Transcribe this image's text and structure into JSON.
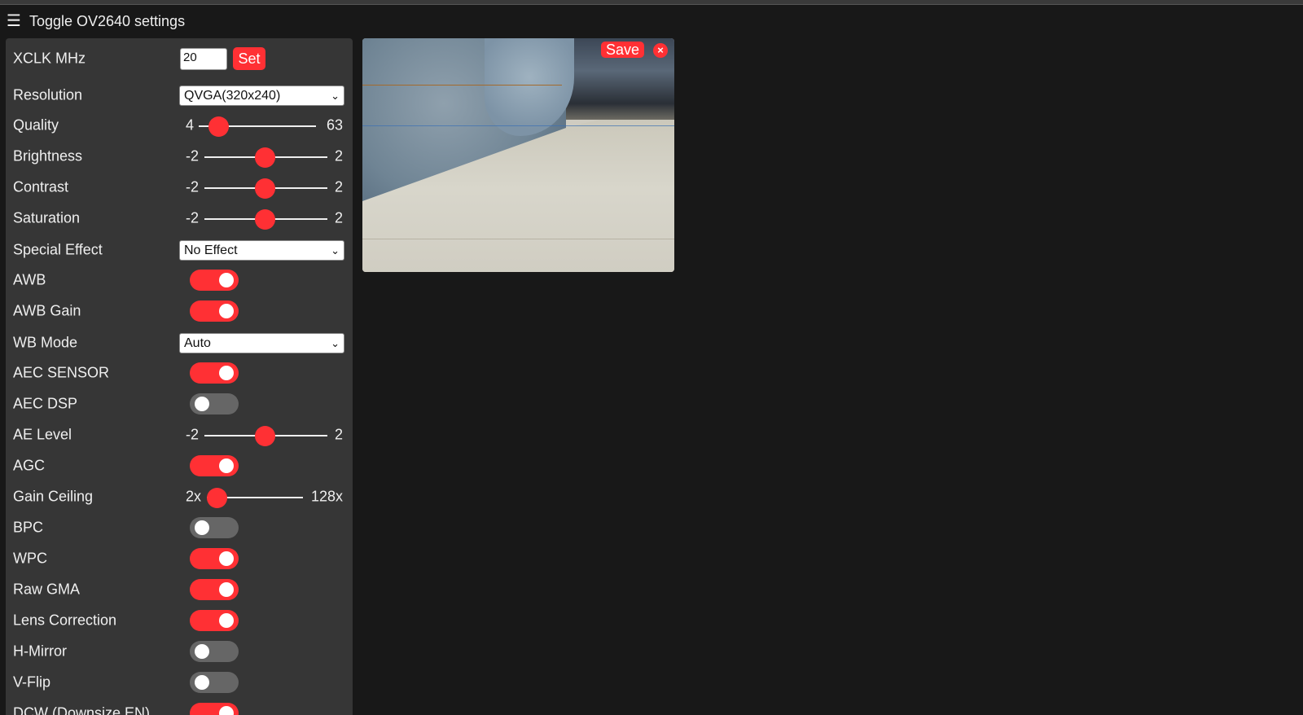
{
  "header": {
    "menu_icon": "☰",
    "title": "Toggle OV2640 settings"
  },
  "settings": {
    "xclk": {
      "label": "XCLK MHz",
      "value": "20",
      "button": "Set"
    },
    "resolution": {
      "label": "Resolution",
      "value": "QVGA(320x240)"
    },
    "quality": {
      "label": "Quality",
      "min": "4",
      "max": "63",
      "value": 10
    },
    "brightness": {
      "label": "Brightness",
      "min": "-2",
      "max": "2",
      "value": 0
    },
    "contrast": {
      "label": "Contrast",
      "min": "-2",
      "max": "2",
      "value": 0
    },
    "saturation": {
      "label": "Saturation",
      "min": "-2",
      "max": "2",
      "value": 0
    },
    "special_effect": {
      "label": "Special Effect",
      "value": "No Effect"
    },
    "awb": {
      "label": "AWB",
      "on": true
    },
    "awb_gain": {
      "label": "AWB Gain",
      "on": true
    },
    "wb_mode": {
      "label": "WB Mode",
      "value": "Auto"
    },
    "aec_sensor": {
      "label": "AEC SENSOR",
      "on": true
    },
    "aec_dsp": {
      "label": "AEC DSP",
      "on": false
    },
    "ae_level": {
      "label": "AE Level",
      "min": "-2",
      "max": "2",
      "value": 0
    },
    "agc": {
      "label": "AGC",
      "on": true
    },
    "gain_ceiling": {
      "label": "Gain Ceiling",
      "min": "2x",
      "max": "128x",
      "value": 0
    },
    "bpc": {
      "label": "BPC",
      "on": false
    },
    "wpc": {
      "label": "WPC",
      "on": true
    },
    "raw_gma": {
      "label": "Raw GMA",
      "on": true
    },
    "lens_correction": {
      "label": "Lens Correction",
      "on": true
    },
    "h_mirror": {
      "label": "H-Mirror",
      "on": false
    },
    "v_flip": {
      "label": "V-Flip",
      "on": false
    },
    "dcw": {
      "label": "DCW (Downsize EN)",
      "on": true
    }
  },
  "stream": {
    "save_label": "Save",
    "close_label": "×"
  },
  "colors": {
    "accent": "#ff3034",
    "panel": "#363636",
    "background": "#181818"
  }
}
